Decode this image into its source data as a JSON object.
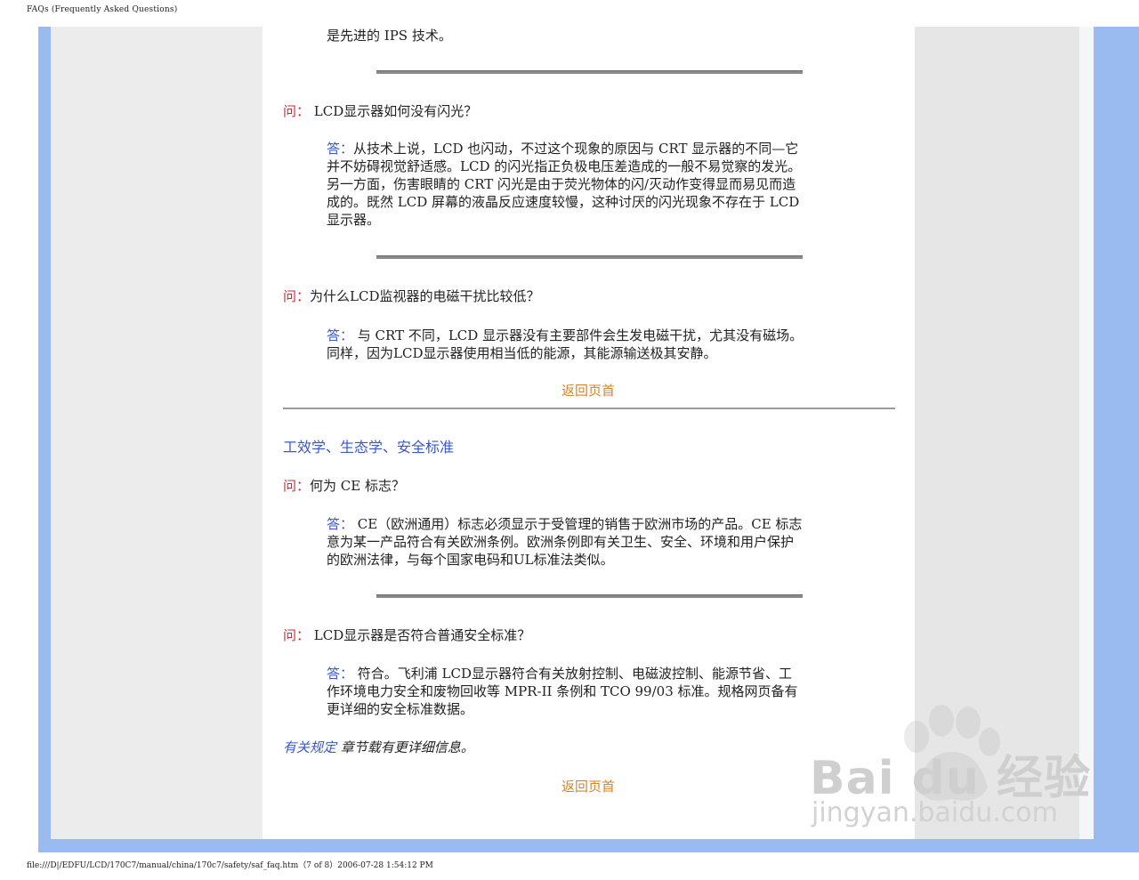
{
  "header": {
    "title": "FAQs (Frequently Asked Questions)"
  },
  "footer": {
    "path": "file:///D|/EDFU/LCD/170C7/manual/china/170c7/safety/saf_faq.htm（7 of 8）2006-07-28 1:54:12 PM"
  },
  "intro_tail": "是先进的 IPS 技术。",
  "faq": [
    {
      "q_label": "问：",
      "question": "LCD显示器如何没有闪光？",
      "a_label": "答：",
      "answer_lines": [
        "从技术上说，LCD 也闪动，不过这个现象的原因与 CRT 显示器的不同—它",
        "并不妨碍视觉舒适感。LCD 的闪光指正负极电压差造成的一般不易觉察的发光。",
        "另一方面，伤害眼睛的 CRT 闪光是由于荧光物体的闪/灭动作变得显而易见而造",
        "成的。既然 LCD 屏幕的液晶反应速度较慢，这种讨厌的闪光现象不存在于 LCD",
        "显示器。"
      ]
    },
    {
      "q_label": "问：",
      "question": "为什么LCD监视器的电磁干扰比较低？",
      "a_label": "答：",
      "answer_lines": [
        " 与 CRT 不同，LCD 显示器没有主要部件会生发电磁干扰，尤其没有磁场。",
        "同样，因为LCD显示器使用相当低的能源，其能源输送极其安静。"
      ]
    }
  ],
  "back_to_top_1": "返回页首",
  "section_title": "工效学、生态学、安全标准",
  "faq2": [
    {
      "q_label": "问：",
      "question": "何为 CE 标志？",
      "a_label": "答：",
      "answer_lines": [
        " CE（欧洲通用）标志必须显示于受管理的销售于欧洲市场的产品。CE 标志",
        "意为某一产品符合有关欧洲条例。欧洲条例即有关卫生、安全、环境和用户保护",
        "的欧洲法律，与每个国家电码和UL标准法类似。"
      ]
    },
    {
      "q_label": "问：",
      "question": "LCD显示器是否符合普通安全标准？",
      "a_label": "答：",
      "answer_lines": [
        " 符合。飞利浦 LCD显示器符合有关放射控制、电磁波控制、能源节省、工",
        "作环境电力安全和废物回收等 MPR-II 条例和 TCO 99/03 标准。规格网页备有",
        "更详细的安全标准数据。"
      ]
    }
  ],
  "regulatory_link": "有关规定",
  "regulatory_suffix": " 章节载有更详细信息。",
  "back_to_top_2": "返回页首",
  "watermark": {
    "brand": "Bai du 经验",
    "url": "jingyan.baidu.com"
  },
  "colors": {
    "question_label": "#d02a2a",
    "answer_label": "#3a58c8",
    "link": "#d4862a",
    "section_title": "#3a58c8",
    "frame_blue": "#99bbf0"
  }
}
